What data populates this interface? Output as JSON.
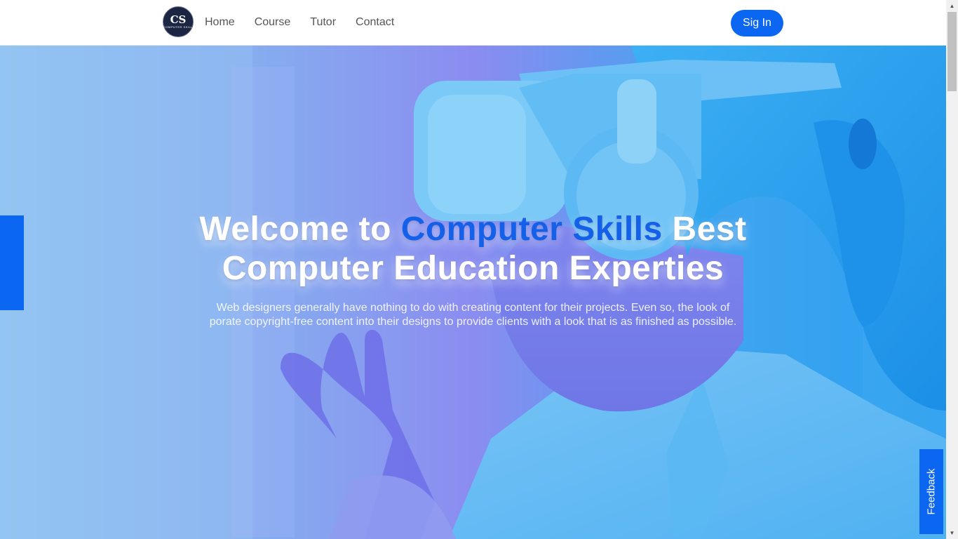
{
  "header": {
    "logo": {
      "mark": "CS",
      "subtitle": "COMPUTER SKILL"
    },
    "nav": [
      {
        "label": "Home"
      },
      {
        "label": "Course"
      },
      {
        "label": "Tutor"
      },
      {
        "label": "Contact"
      }
    ],
    "signin_label": "Sig In"
  },
  "hero": {
    "title_part1": "Welcome to ",
    "title_accent": "Computer Skills",
    "title_part2": " Best",
    "title_line2": "Computer Education Experties",
    "subtitle_line1": "Web designers generally have nothing to do with creating content for their projects. Even so, the look of",
    "subtitle_line2": "porate copyright-free content into their designs to provide clients with a look that is as finished as possible."
  },
  "feedback_label": "Feedback",
  "colors": {
    "accent": "#0b66f2",
    "title_accent": "#1560e8",
    "logo_bg": "#1c2541"
  },
  "icons": {
    "scroll_up": "scroll-up-arrow-icon",
    "scroll_down": "scroll-down-arrow-icon"
  }
}
